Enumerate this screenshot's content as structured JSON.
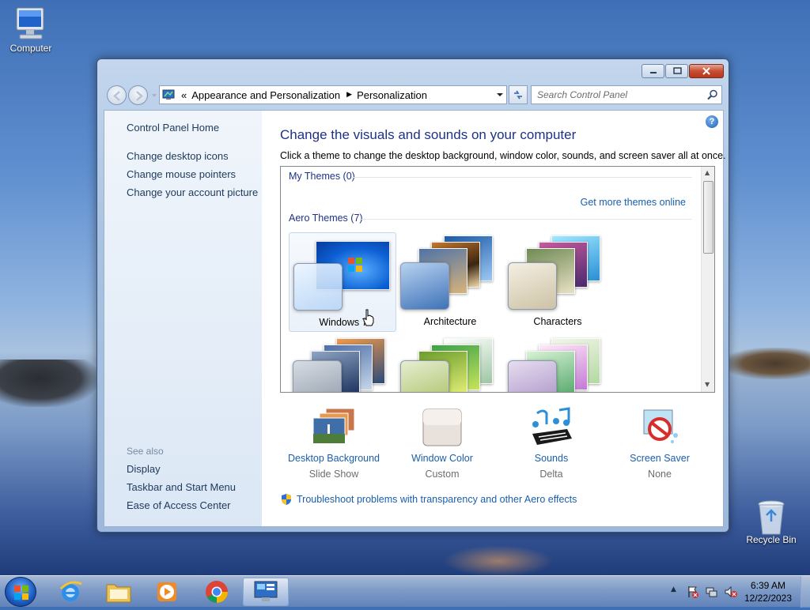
{
  "desktop": {
    "icons": [
      {
        "label": "Computer"
      },
      {
        "label": "Recycle Bin"
      }
    ]
  },
  "window": {
    "address": {
      "chevron": "«",
      "crumbs": [
        "Appearance and Personalization",
        "Personalization"
      ]
    },
    "search": {
      "placeholder": "Search Control Panel"
    },
    "sidebar": {
      "home": "Control Panel Home",
      "links": [
        "Change desktop icons",
        "Change mouse pointers",
        "Change your account picture"
      ],
      "see_also_label": "See also",
      "see_also": [
        "Display",
        "Taskbar and Start Menu",
        "Ease of Access Center"
      ]
    },
    "main": {
      "help": "?",
      "heading": "Change the visuals and sounds on your computer",
      "subtext": "Click a theme to change the desktop background, window color, sounds, and screen saver all at once.",
      "my_themes": "My Themes (0)",
      "get_more": "Get more themes online",
      "aero_themes": "Aero Themes (7)",
      "themes": [
        {
          "label": "Windows 7",
          "selected": true
        },
        {
          "label": "Architecture"
        },
        {
          "label": "Characters"
        },
        {
          "label": ""
        },
        {
          "label": ""
        },
        {
          "label": ""
        }
      ],
      "tools": [
        {
          "name": "Desktop Background",
          "value": "Slide Show"
        },
        {
          "name": "Window Color",
          "value": "Custom"
        },
        {
          "name": "Sounds",
          "value": "Delta"
        },
        {
          "name": "Screen Saver",
          "value": "None"
        }
      ],
      "troubleshoot": "Troubleshoot problems with transparency and other Aero effects"
    }
  },
  "taskbar": {
    "items": [
      "start-button",
      "internet-explorer",
      "windows-explorer",
      "media-player",
      "chrome",
      "control-panel"
    ],
    "clock": {
      "time": "6:39 AM",
      "date": "12/22/2023"
    }
  },
  "colors": {
    "link": "#1a5eab",
    "heading": "#1e3287"
  }
}
